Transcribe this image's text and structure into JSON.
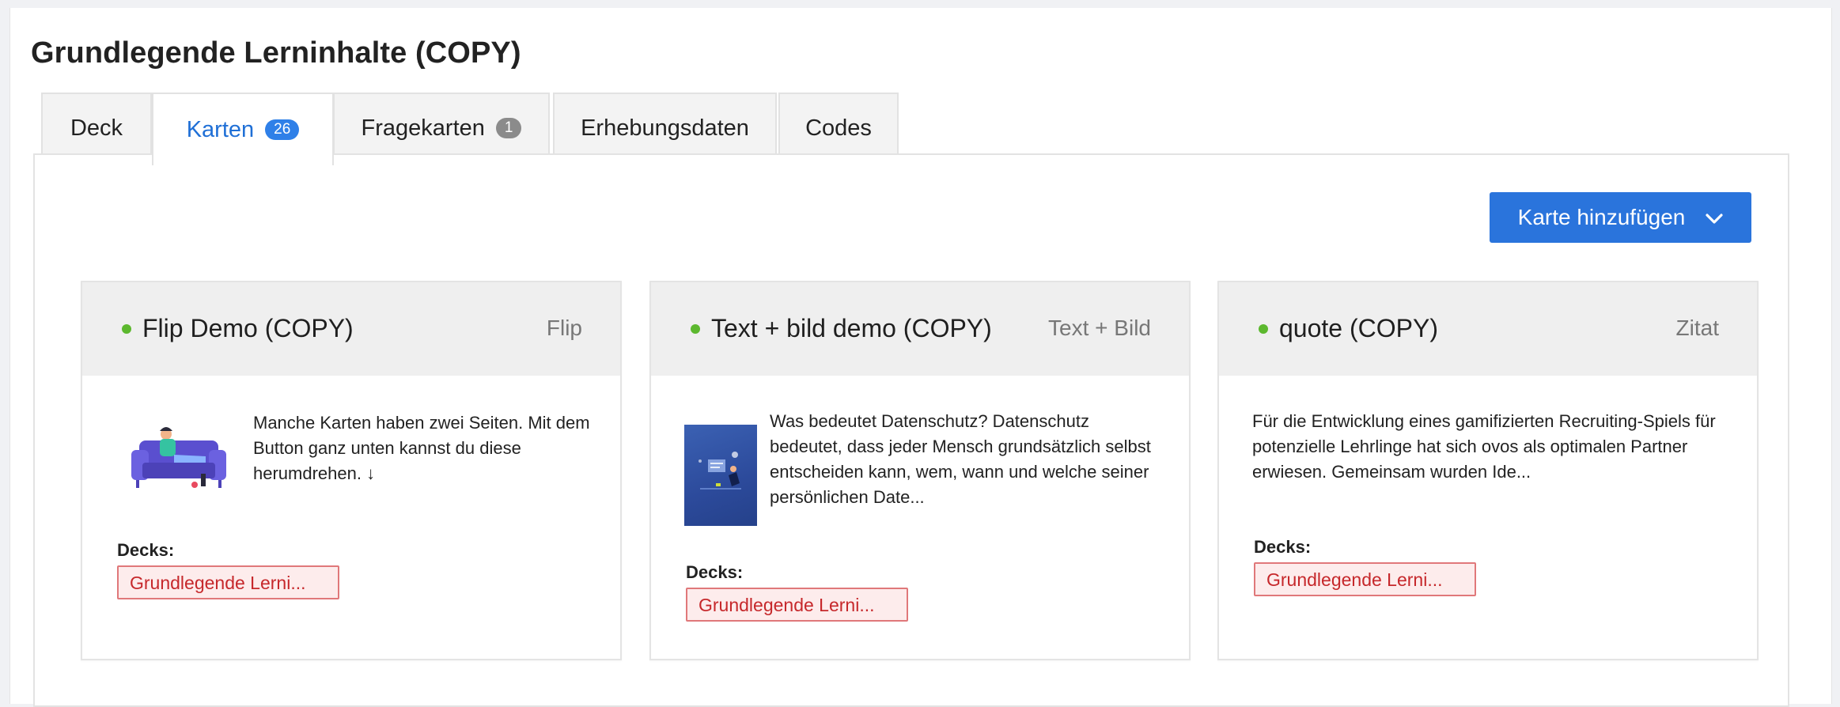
{
  "page": {
    "title": "Grundlegende Lerninhalte (COPY)"
  },
  "tabs": [
    {
      "label": "Deck",
      "badge": null,
      "active": false
    },
    {
      "label": "Karten",
      "badge": "26",
      "active": true
    },
    {
      "label": "Fragekarten",
      "badge": "1",
      "active": false
    },
    {
      "label": "Erhebungsdaten",
      "badge": null,
      "active": false
    },
    {
      "label": "Codes",
      "badge": null,
      "active": false
    }
  ],
  "toolbar": {
    "add_card_label": "Karte hinzufügen",
    "add_card_icon": "chevron-down-icon"
  },
  "cards": [
    {
      "title": "Flip Demo (COPY)",
      "type": "Flip",
      "status_color": "#5cb82e",
      "thumbnail": "couch-illustration",
      "text": "Manche Karten haben zwei Seiten. Mit dem Button ganz unten kannst du diese herumdrehen. ↓",
      "decks_label": "Decks:",
      "decks": [
        "Grundlegende Lerni..."
      ]
    },
    {
      "title": "Text + bild demo (COPY)",
      "type": "Text + Bild",
      "status_color": "#5cb82e",
      "thumbnail": "book-cover-illustration",
      "text": "Was bedeutet Datenschutz? Datenschutz bedeutet, dass jeder Mensch grundsätzlich selbst entscheiden kann, wem, wann und welche seiner persönlichen Date...",
      "decks_label": "Decks:",
      "decks": [
        "Grundlegende Lerni..."
      ]
    },
    {
      "title": "quote (COPY)",
      "type": "Zitat",
      "status_color": "#5cb82e",
      "thumbnail": null,
      "text": "Für die Entwicklung eines gamifizierten Recruiting-Spiels für potenzielle Lehrlinge hat sich ovos als optimalen Partner erwiesen. Gemeinsam wurden Ide...",
      "decks_label": "Decks:",
      "decks": [
        "Grundlegende Lerni..."
      ]
    }
  ],
  "colors": {
    "accent": "#2a74dc",
    "active_tab_text": "#1f6fd6",
    "badge_blue": "#2f80e8",
    "badge_gray": "#8b8b8b",
    "deck_tag_border": "#e0787a",
    "deck_tag_bg": "#fdecec",
    "deck_tag_text": "#c6282b"
  }
}
